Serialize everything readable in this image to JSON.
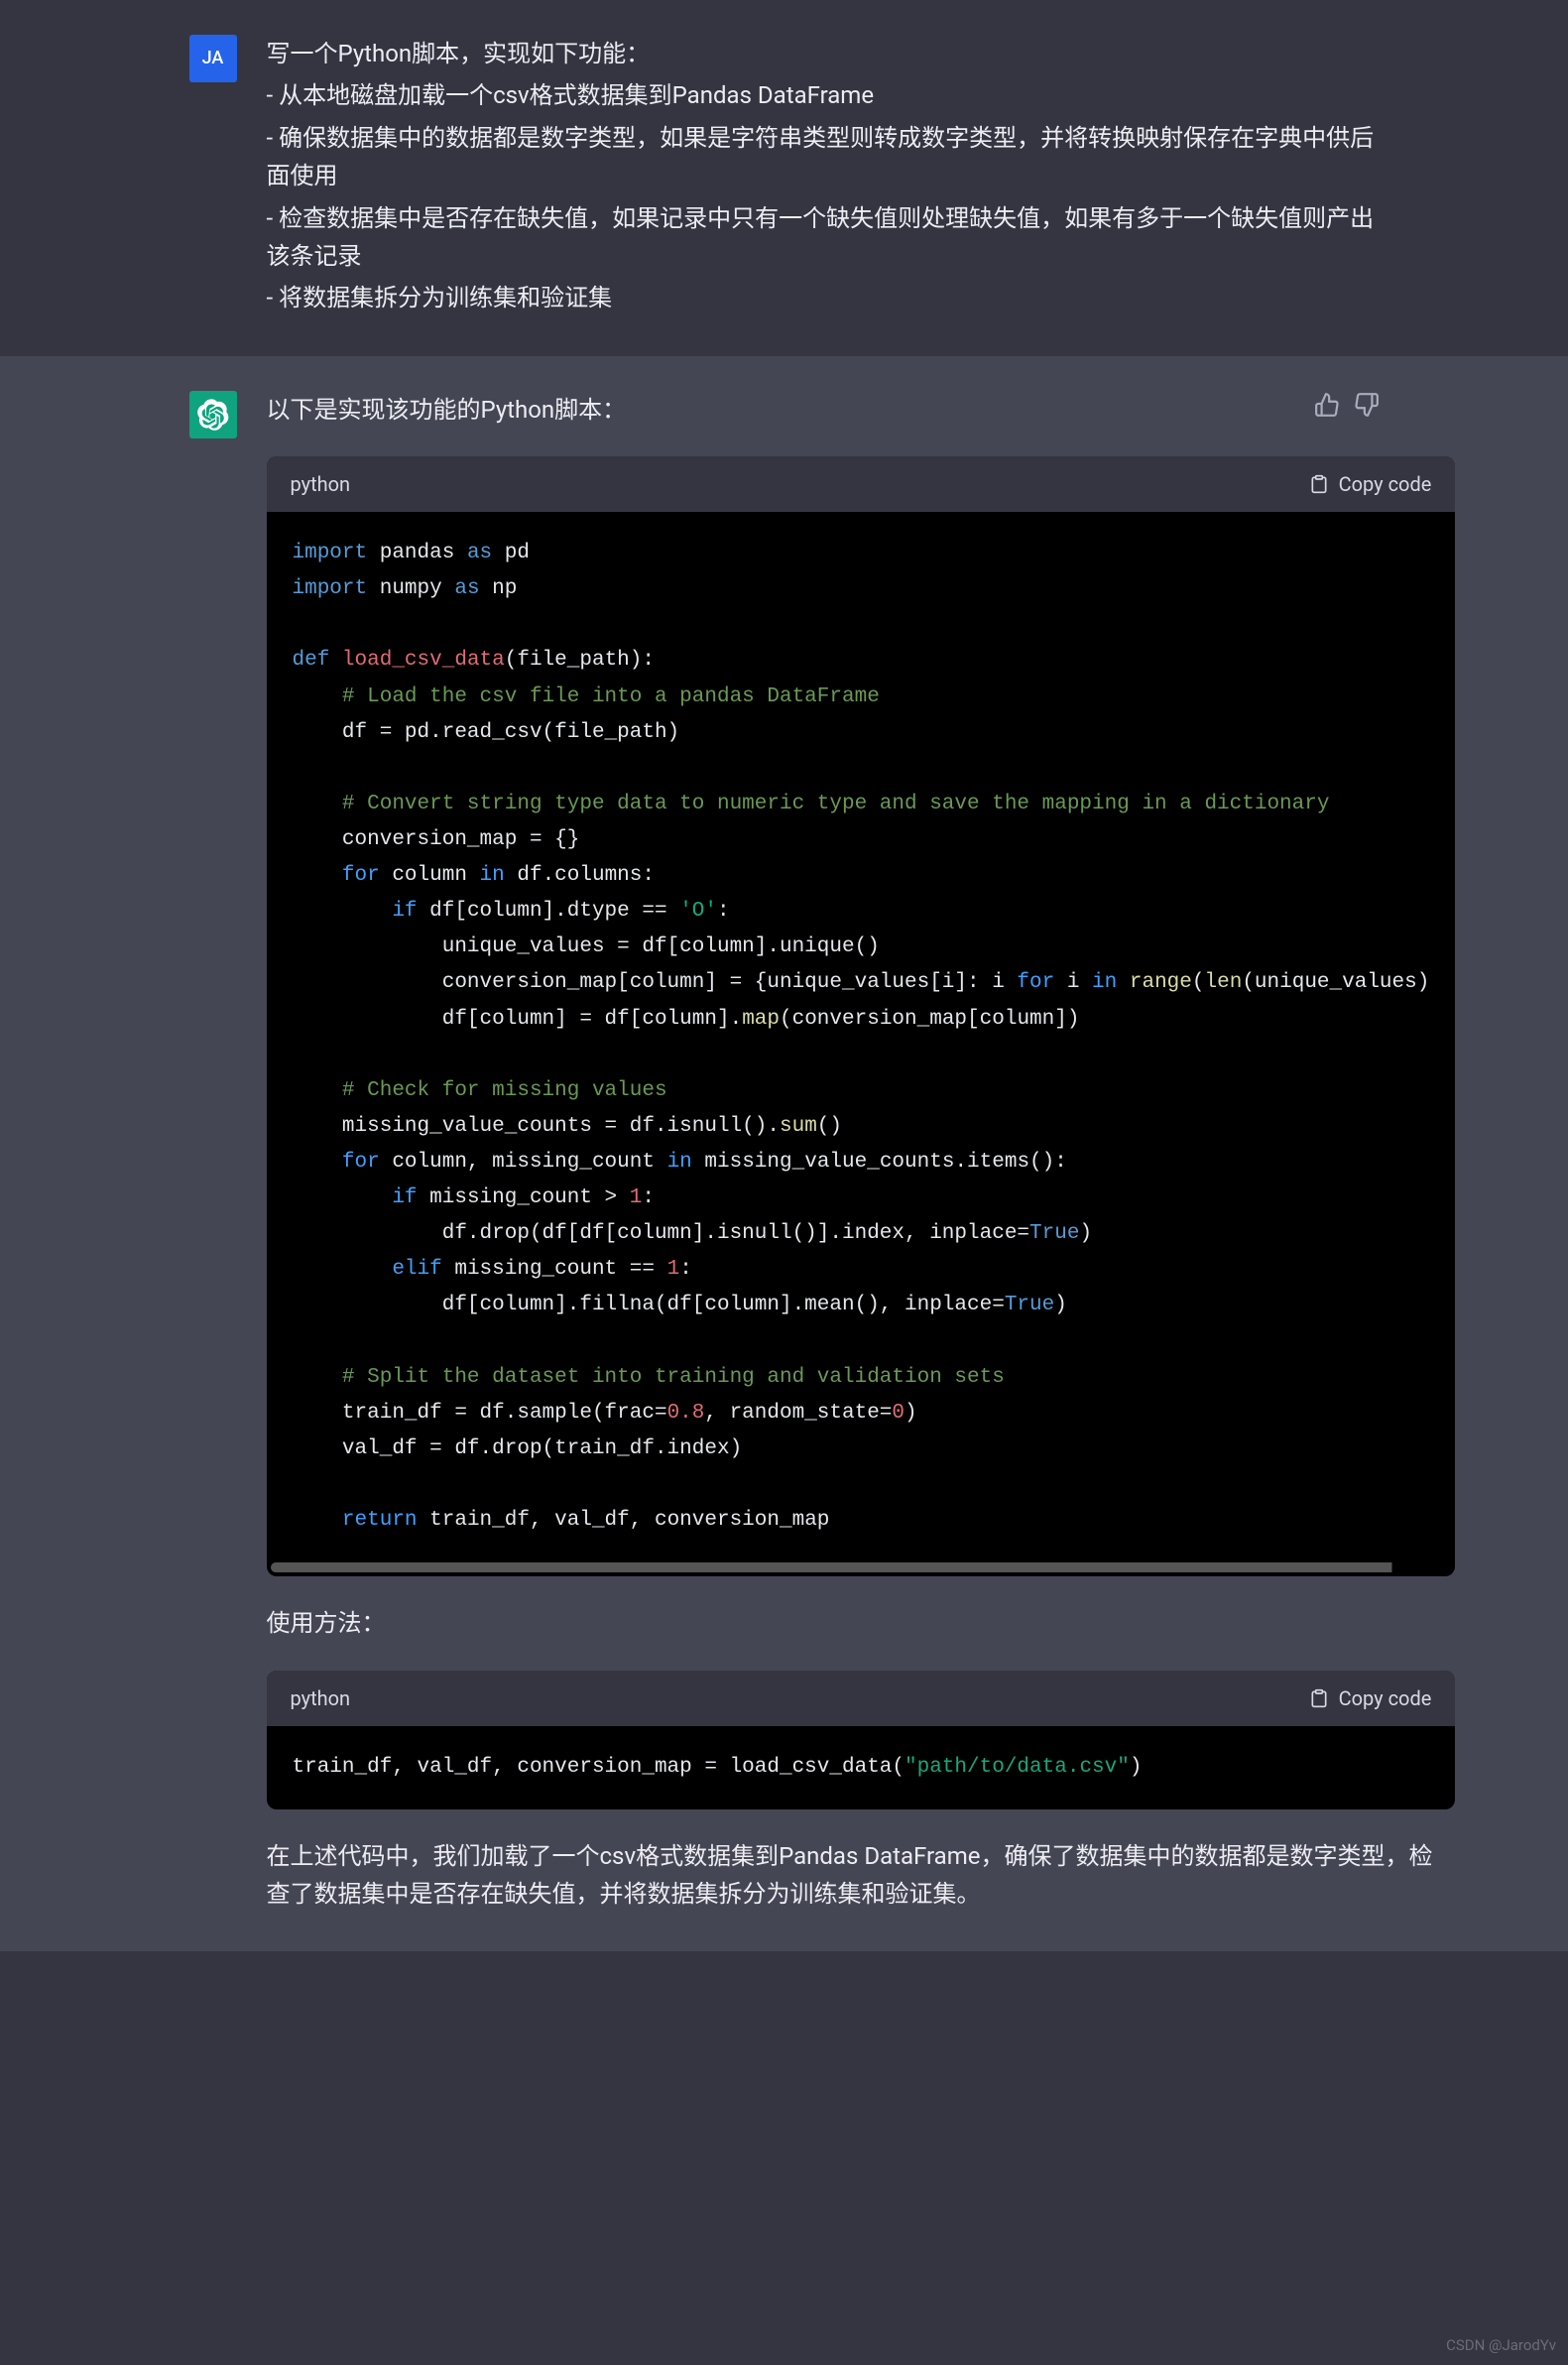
{
  "user": {
    "avatar_initials": "JA",
    "lines": [
      "写一个Python脚本，实现如下功能：",
      "- 从本地磁盘加载一个csv格式数据集到Pandas DataFrame",
      "- 确保数据集中的数据都是数字类型，如果是字符串类型则转成数字类型，并将转换映射保存在字典中供后面使用",
      "- 检查数据集中是否存在缺失值，如果记录中只有一个缺失值则处理缺失值，如果有多于一个缺失值则产出该条记录",
      "- 将数据集拆分为训练集和验证集"
    ]
  },
  "assistant": {
    "intro": "以下是实现该功能的Python脚本：",
    "code_lang": "python",
    "copy_label": "Copy code",
    "code1": {
      "l1_import": "import",
      "l1_lib": " pandas ",
      "l1_as": "as",
      "l1_alias": " pd",
      "l2_import": "import",
      "l2_lib": " numpy ",
      "l2_as": "as",
      "l2_alias": " np",
      "l4_def": "def ",
      "l4_name": "load_csv_data",
      "l4_sig": "(file_path):",
      "l5": "    # Load the csv file into a pandas DataFrame",
      "l6": "    df = pd.read_csv(file_path)",
      "l8": "    # Convert string type data to numeric type and save the mapping in a dictionary",
      "l9": "    conversion_map = {}",
      "l10_for": "    for",
      "l10_mid": " column ",
      "l10_in": "in",
      "l10_end": " df.columns:",
      "l11_if": "        if",
      "l11_mid": " df[column].dtype == ",
      "l11_str": "'O'",
      "l11_end": ":",
      "l12": "            unique_values = df[column].unique()",
      "l13a": "            conversion_map[column] = {unique_values[i]: i ",
      "l13_for": "for",
      "l13b": " i ",
      "l13_in": "in",
      "l13c": " ",
      "l13_range": "range",
      "l13d": "(",
      "l13_len": "len",
      "l13e": "(unique_values)",
      "l14a": "            df[column] = df[column].",
      "l14_map": "map",
      "l14b": "(conversion_map[column])",
      "l16": "    # Check for missing values",
      "l17a": "    missing_value_counts = df.isnull().",
      "l17_sum": "sum",
      "l17b": "()",
      "l18_for": "    for",
      "l18a": " column, missing_count ",
      "l18_in": "in",
      "l18b": " missing_value_counts.items():",
      "l19_if": "        if",
      "l19a": " missing_count > ",
      "l19_num": "1",
      "l19b": ":",
      "l20a": "            df.drop(df[df[column].isnull()].index, inplace=",
      "l20_true": "True",
      "l20b": ")",
      "l21_elif": "        elif",
      "l21a": " missing_count == ",
      "l21_num": "1",
      "l21b": ":",
      "l22a": "            df[column].fillna(df[column].mean(), inplace=",
      "l22_true": "True",
      "l22b": ")",
      "l24": "    # Split the dataset into training and validation sets",
      "l25a": "    train_df = df.sample(frac=",
      "l25_n1": "0.8",
      "l25b": ", random_state=",
      "l25_n2": "0",
      "l25c": ")",
      "l26": "    val_df = df.drop(train_df.index)",
      "l28_ret": "    return",
      "l28a": " train_df, val_df, conversion_map"
    },
    "usage_label": "使用方法：",
    "code2": {
      "a": "train_df, val_df, conversion_map = load_csv_data(",
      "str": "\"path/to/data.csv\"",
      "b": ")"
    },
    "closing": "在上述代码中，我们加载了一个csv格式数据集到Pandas DataFrame，确保了数据集中的数据都是数字类型，检查了数据集中是否存在缺失值，并将数据集拆分为训练集和验证集。"
  },
  "watermark": "CSDN @JarodYv"
}
